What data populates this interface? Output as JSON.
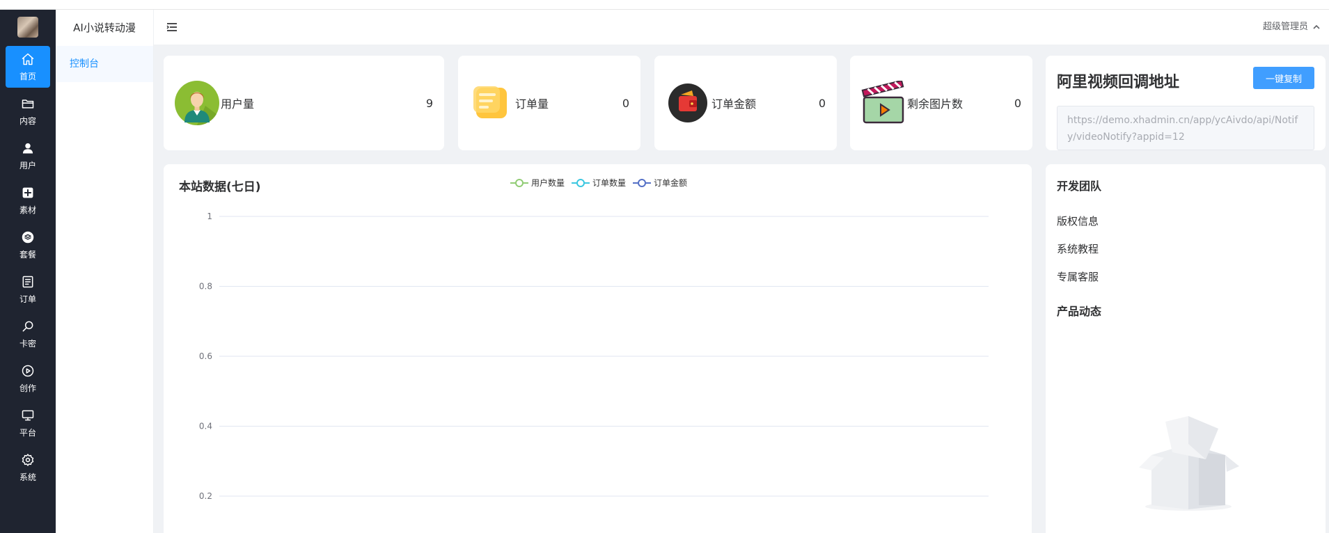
{
  "app": {
    "title": "AI小说转动漫"
  },
  "rail": {
    "items": [
      {
        "label": "首页",
        "icon": "home-icon",
        "active": true
      },
      {
        "label": "内容",
        "icon": "folder-icon"
      },
      {
        "label": "用户",
        "icon": "user-icon"
      },
      {
        "label": "素材",
        "icon": "material-icon"
      },
      {
        "label": "套餐",
        "icon": "package-icon"
      },
      {
        "label": "订单",
        "icon": "order-icon"
      },
      {
        "label": "卡密",
        "icon": "search-icon"
      },
      {
        "label": "创作",
        "icon": "play-icon"
      },
      {
        "label": "平台",
        "icon": "monitor-icon"
      },
      {
        "label": "系统",
        "icon": "gear-icon"
      }
    ]
  },
  "submenu": {
    "items": [
      {
        "label": "控制台"
      }
    ]
  },
  "header": {
    "user": "超级管理员"
  },
  "stats": [
    {
      "label": "用户量",
      "value": "9",
      "icon": "user-avatar-icon"
    },
    {
      "label": "订单量",
      "value": "0",
      "icon": "order-doc-icon"
    },
    {
      "label": "订单金额",
      "value": "0",
      "icon": "wallet-icon"
    },
    {
      "label": "剩余图片数",
      "value": "0",
      "icon": "clapperboard-icon"
    }
  ],
  "callback": {
    "title": "阿里视频回调地址",
    "copy_label": "一键复制",
    "url": "https://demo.xhadmin.cn/app/ycAivdo/api/Notify/videoNotify?appid=12"
  },
  "chart": {
    "title": "本站数据(七日)"
  },
  "chart_data": {
    "type": "line",
    "title": "本站数据(七日)",
    "series": [
      {
        "name": "用户数量",
        "color": "#91cc75",
        "values": []
      },
      {
        "name": "订单数量",
        "color": "#3bc7e0",
        "values": []
      },
      {
        "name": "订单金额",
        "color": "#5470c6",
        "values": []
      }
    ],
    "ylim": [
      0,
      1
    ],
    "yticks": [
      "1",
      "0.8",
      "0.6",
      "0.4",
      "0.2"
    ],
    "grid": true,
    "legend": "top-center"
  },
  "team": {
    "title": "开发团队",
    "links": [
      {
        "label": "版权信息"
      },
      {
        "label": "系统教程"
      },
      {
        "label": "专属客服"
      }
    ],
    "news_title": "产品动态"
  },
  "colors": {
    "accent": "#1890ff",
    "rail_bg": "#1f2430",
    "button": "#409eff"
  }
}
